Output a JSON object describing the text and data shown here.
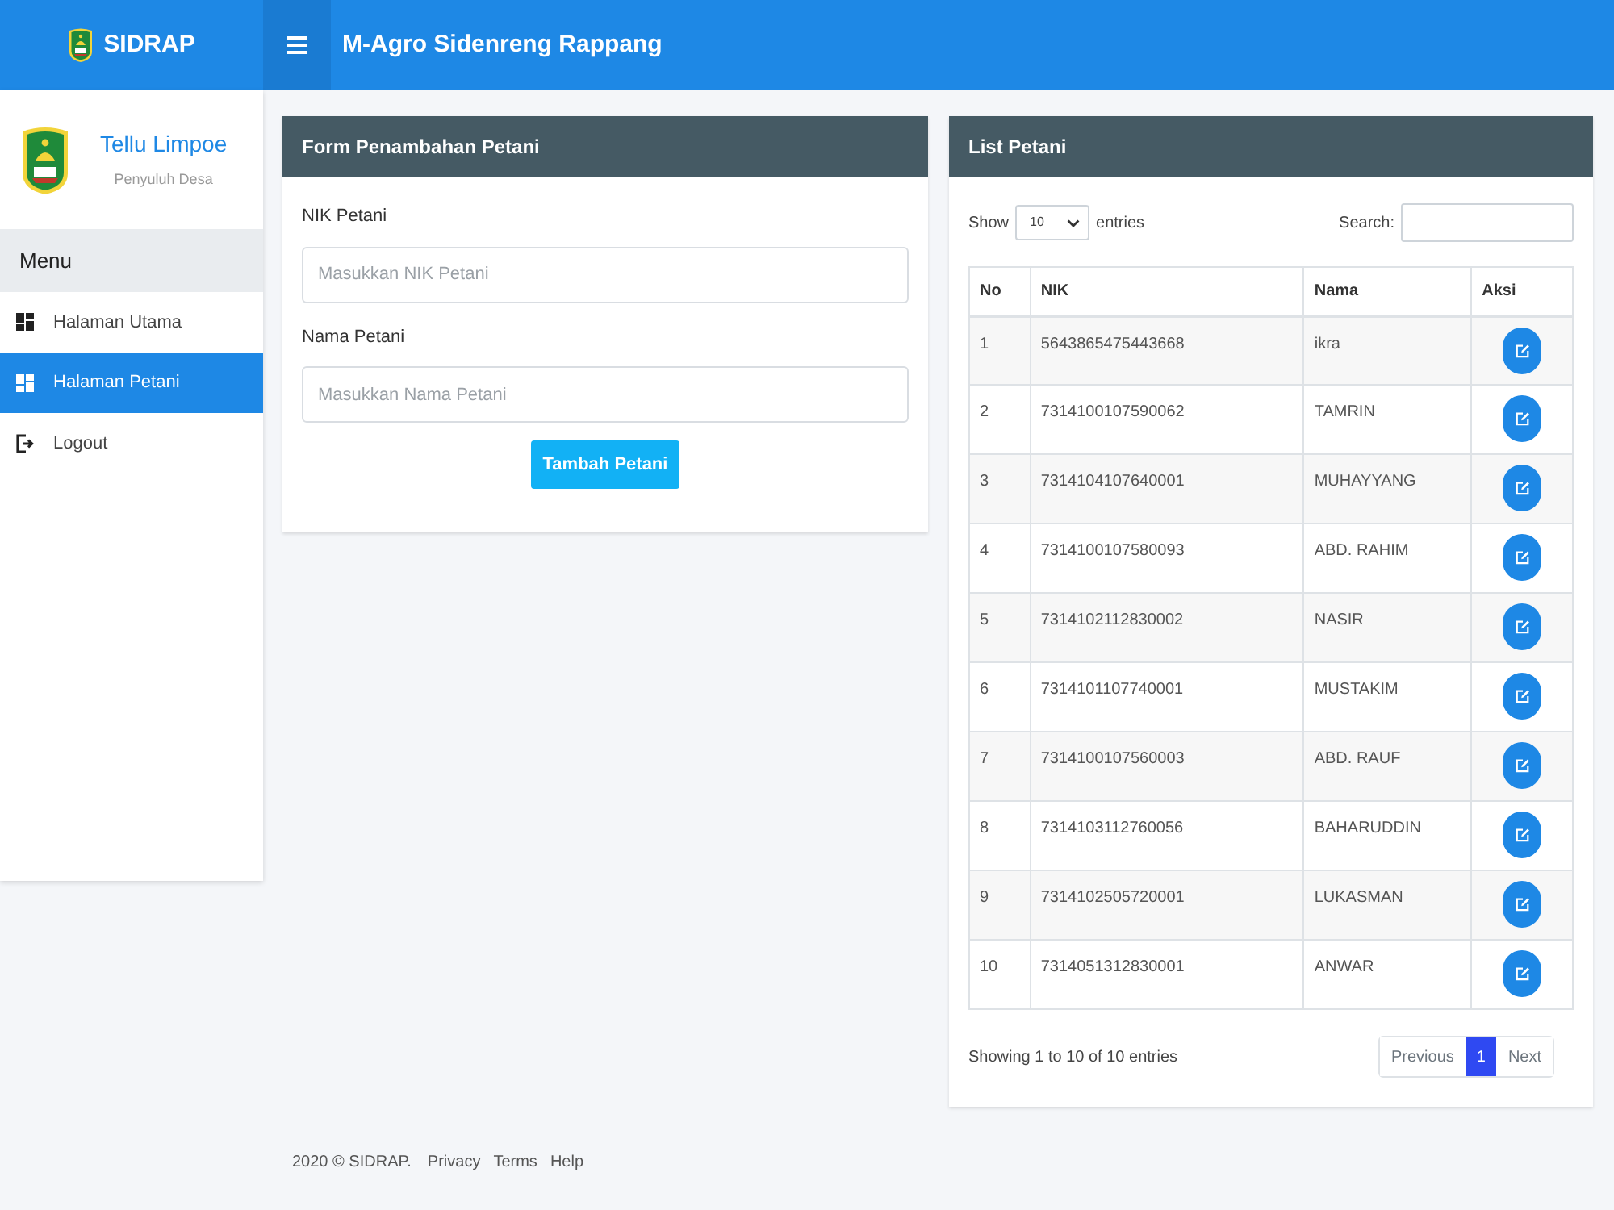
{
  "navbar": {
    "brand": "SIDRAP",
    "title": "M-Agro Sidenreng Rappang"
  },
  "sidebar": {
    "user": {
      "name": "Tellu Limpoe",
      "role": "Penyuluh Desa"
    },
    "menu_title": "Menu",
    "items": [
      {
        "label": "Halaman Utama",
        "kind": "page",
        "selected": false
      },
      {
        "label": "Halaman Petani",
        "kind": "page",
        "selected": true
      },
      {
        "label": "Logout",
        "kind": "logout",
        "selected": false
      }
    ]
  },
  "form_card": {
    "title": "Form Penambahan Petani",
    "fields": [
      {
        "label": "NIK Petani",
        "placeholder": "Masukkan NIK Petani"
      },
      {
        "label": "Nama Petani",
        "placeholder": "Masukkan Nama Petani"
      }
    ],
    "submit": "Tambah Petani"
  },
  "list_card": {
    "title": "List Petani",
    "length_menu": {
      "before": "Show",
      "value": "10",
      "after": "entries"
    },
    "search": {
      "label": "Search:"
    },
    "table": {
      "columns": [
        "No",
        "NIK",
        "Nama",
        "Aksi"
      ],
      "rows": [
        {
          "no": "1",
          "nik": "5643865475443668",
          "nama": "ikra"
        },
        {
          "no": "2",
          "nik": "7314100107590062",
          "nama": "TAMRIN"
        },
        {
          "no": "3",
          "nik": "7314104107640001",
          "nama": "MUHAYYANG"
        },
        {
          "no": "4",
          "nik": "7314100107580093",
          "nama": "ABD. RAHIM"
        },
        {
          "no": "5",
          "nik": "7314102112830002",
          "nama": "NASIR"
        },
        {
          "no": "6",
          "nik": "7314101107740001",
          "nama": "MUSTAKIM"
        },
        {
          "no": "7",
          "nik": "7314100107560003",
          "nama": "ABD. RAUF"
        },
        {
          "no": "8",
          "nik": "7314103112760056",
          "nama": "BAHARUDDIN"
        },
        {
          "no": "9",
          "nik": "7314102505720001",
          "nama": "LUKASMAN"
        },
        {
          "no": "10",
          "nik": "7314051312830001",
          "nama": "ANWAR"
        }
      ]
    },
    "info": "Showing 1 to 10 of 10 entries",
    "pagination": [
      {
        "label": "Previous",
        "selected": false,
        "disabled": true
      },
      {
        "label": "1",
        "selected": true,
        "disabled": false
      },
      {
        "label": "Next",
        "selected": false,
        "disabled": true
      }
    ]
  },
  "footer": {
    "copyright": "2020 © SIDRAP.",
    "links": [
      "Privacy",
      "Terms",
      "Help"
    ]
  }
}
